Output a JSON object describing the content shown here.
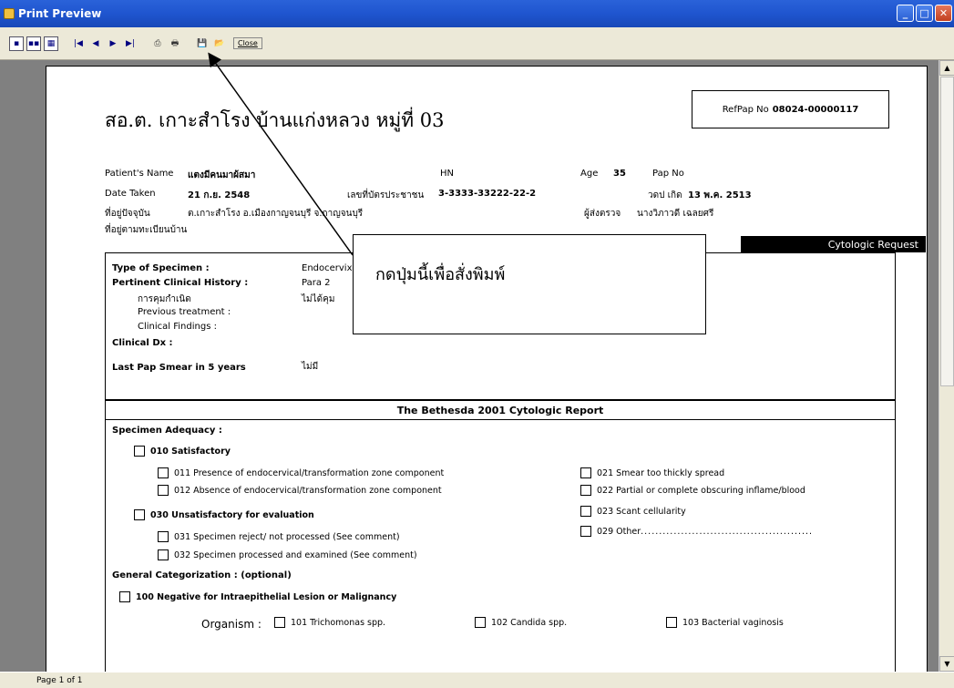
{
  "window": {
    "title": "Print Preview",
    "min": "_",
    "max": "□",
    "close": "✕"
  },
  "toolbar": {
    "close_label": "Close"
  },
  "status": {
    "page": "Page 1 of 1"
  },
  "report": {
    "heading": "สอ.ต. เกาะสำโรง บ้านแก่งหลวง หมู่ที่ 03",
    "ref_label": "RefPap No",
    "ref_value": "08024-00000117",
    "patient_label": "Patient's Name",
    "patient_value": "แตงมีคนมาผ้สมา",
    "hn_label": "HN",
    "age_label": "Age",
    "age_value": "35",
    "papno_label": "Pap No",
    "date_label": "Date Taken",
    "date_value": "21 ก.ย. 2548",
    "idcard_label": "เลขที่บัตรประชาชน",
    "idcard_value": "3-3333-33222-22-2",
    "dob_label": "วดป เกิด",
    "dob_value": "13 พ.ค. 2513",
    "current_addr_label": "ที่อยู่ปัจจุบัน",
    "current_addr_value": "ต.เกาะสำโรง อ.เมืองกาญจนบุรี จ.กาญจนบุรี",
    "sender_label": "ผู้ส่งตรวจ",
    "sender_value": "นางวิภาวดี เฉลยศรี",
    "home_addr_label": "ที่อยู่ตามทะเบียนบ้าน",
    "cyto_request": "Cytologic Request",
    "type_label": "Type of Specimen :",
    "type_value": "Endocervix",
    "history_label": "Pertinent Clinical History :",
    "para": "Para  2",
    "birth_control_label": "การคุมกำเนิด",
    "birth_control_value": "ไม่ได้คุม",
    "previous_treatment": "Previous treatment :",
    "clinical_findings": "Clinical Findings :",
    "clinical_dx": "Clinical Dx :",
    "last_pap_label": "Last Pap Smear in 5 years",
    "last_pap_value": "ไม่มี",
    "bethesda": "The Bethesda 2001 Cytologic Report",
    "adequacy": "Specimen Adequacy :",
    "s010": "010 Satisfactory",
    "s011": "011 Presence of endocervical/transformation zone component",
    "s012": "012 Absence of endocervical/transformation zone component",
    "s030": "030 Unsatisfactory for evaluation",
    "s031": "031 Specimen reject/ not processed (See comment)",
    "s032": "032 Specimen processed and examined (See comment)",
    "s021": "021 Smear too thickly spread",
    "s022": "022 Partial or complete obscuring inflame/blood",
    "s023": "023 Scant cellularity",
    "s029": "029 Other",
    "s029_dots": "...............................................",
    "general": "General Categorization : (optional)",
    "s100": "100 Negative for Intraepithelial Lesion or Malignancy",
    "organism": "Organism :",
    "s101": "101 Trichomonas spp.",
    "s102": "102 Candida spp.",
    "s103": "103 Bacterial vaginosis"
  },
  "callout": {
    "text": "กดปุ่มนี้เพื่อสั่งพิมพ์"
  },
  "icons": [
    "one-page-icon",
    "two-page-icon",
    "multi-page-icon",
    "first-page-icon",
    "prev-page-icon",
    "next-page-icon",
    "last-page-icon",
    "print-setup-icon",
    "print-icon",
    "save-icon",
    "export-icon"
  ]
}
